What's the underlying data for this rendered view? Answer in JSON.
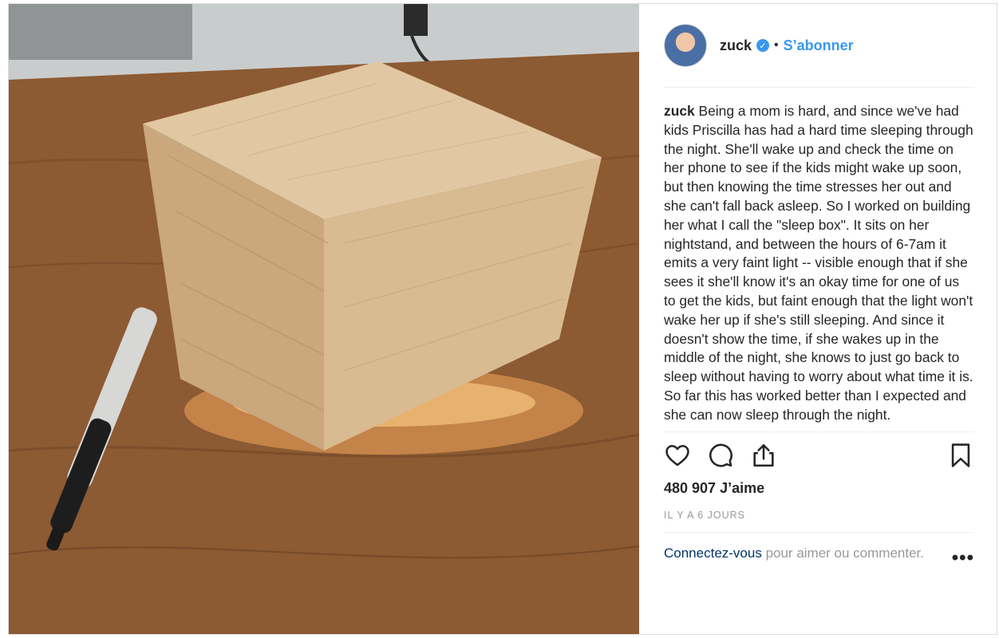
{
  "post": {
    "username": "zuck",
    "verified_icon": "verified-badge-icon",
    "separator": "•",
    "follow_label": "S’abonner",
    "caption_user": "zuck",
    "caption_text": "Being a mom is hard, and since we've had kids Priscilla has had a hard time sleeping through the night. She'll wake up and check the time on her phone to see if the kids might wake up soon, but then knowing the time stresses her out and she can't fall back asleep. So I worked on building her what I call the \"sleep box\". It sits on her nightstand, and between the hours of 6-7am it emits a very faint light -- visible enough that if she sees it she'll know it's an okay time for one of us to get the kids, but faint enough that the light won't wake her up if she's still sleeping. And since it doesn't show the time, if she wakes up in the middle of the night, she knows to just go back to sleep without having to worry about what time it is. So far this has worked better than I expected and she can now sleep through the night.",
    "likes": "480 907 J’aime",
    "timestamp": "IL Y A 6 JOURS",
    "login_link": "Connectez-vous",
    "login_rest": " pour aimer ou commenter.",
    "more_label": "•••"
  },
  "icons": {
    "like": "heart-icon",
    "comment": "comment-icon",
    "share": "share-icon",
    "save": "bookmark-icon"
  },
  "colors": {
    "accent": "#3897f0",
    "link_dark": "#003569",
    "text": "#262626",
    "muted": "#999999"
  }
}
